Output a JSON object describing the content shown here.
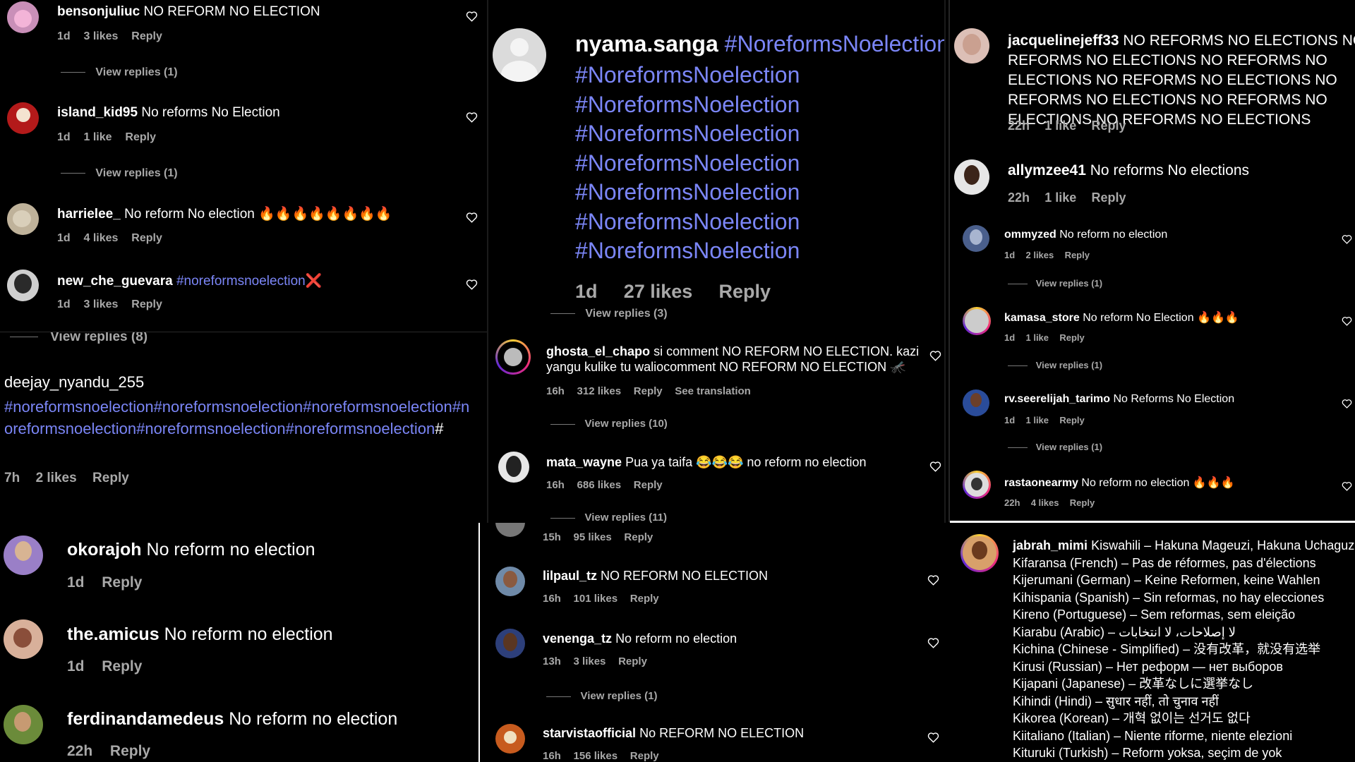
{
  "p1": {
    "comments": [
      {
        "user": "bensonjuliuc",
        "text": "NO REFORM NO ELECTION",
        "time": "1d",
        "likes": "3 likes",
        "reply": "Reply",
        "replies": "View replies (1)"
      },
      {
        "user": "island_kid95",
        "text": "No reforms No Election",
        "time": "1d",
        "likes": "1 like",
        "reply": "Reply",
        "replies": "View replies (1)"
      },
      {
        "user": "harrielee_",
        "text": "No reform No election 🔥🔥🔥🔥🔥🔥🔥🔥",
        "time": "1d",
        "likes": "4 likes",
        "reply": "Reply"
      },
      {
        "user": "new_che_guevara",
        "tag": "#noreformsnoelection",
        "emoji": "❌",
        "time": "1d",
        "likes": "3 likes",
        "reply": "Reply"
      }
    ],
    "replies_bottom": "View replies (8)"
  },
  "p2": {
    "user": "deejay_nyandu_255",
    "tags": "#noreformsnoelection#noreformsnoelection#noreformsnoelection#noreformsnoelection#noreformsnoelection#noreformsnoelection",
    "tail": "#",
    "time": "7h",
    "likes": "2 likes",
    "reply": "Reply"
  },
  "p3": {
    "comments": [
      {
        "user": "okorajoh",
        "text": "No reform no election",
        "time": "1d",
        "reply": "Reply"
      },
      {
        "user": "the.amicus",
        "text": "No reform no election",
        "time": "1d",
        "reply": "Reply"
      },
      {
        "user": "ferdinandamedeus",
        "text": "No reform no election",
        "time": "22h",
        "reply": "Reply"
      }
    ]
  },
  "p4": {
    "user": "nyama.sanga",
    "tag": "#NoreformsNoelection",
    "tags": [
      "#NoreformsNoelection",
      "#NoreformsNoelection",
      "#NoreformsNoelection",
      "#NoreformsNoelection",
      "#NoreformsNoelection",
      "#NoreformsNoelection",
      "#NoreformsNoelection"
    ],
    "time": "1d",
    "likes": "27 likes",
    "reply": "Reply",
    "replies_cut": "View replies (3)"
  },
  "p5": {
    "comments": [
      {
        "user": "ghosta_el_chapo",
        "text": "si comment NO REFORM NO ELECTION. kazi yangu kulike tu waliocomment NO REFORM NO ELECTION 🦟",
        "time": "16h",
        "likes": "312 likes",
        "reply": "Reply",
        "translate": "See translation",
        "replies": "View replies (10)"
      },
      {
        "user": "mata_wayne",
        "text": "Pua ya taifa 😂😂😂 no reform no election",
        "time": "16h",
        "likes": "686 likes",
        "reply": "Reply",
        "replies": "View replies (11)"
      }
    ]
  },
  "p6": {
    "partial": {
      "time": "15h",
      "likes": "95 likes",
      "reply": "Reply"
    },
    "comments": [
      {
        "user": "lilpaul_tz",
        "text": "NO REFORM NO ELECTION",
        "time": "16h",
        "likes": "101 likes",
        "reply": "Reply"
      },
      {
        "user": "venenga_tz",
        "text": "No reform no election",
        "time": "13h",
        "likes": "3 likes",
        "reply": "Reply",
        "replies": "View replies (1)"
      },
      {
        "user": "starvistaofficial",
        "text": "No REFORM NO ELECTION",
        "time": "16h",
        "likes": "156 likes",
        "reply": "Reply"
      }
    ]
  },
  "p7": {
    "comments": [
      {
        "user": "jacquelinejeff33",
        "text": "NO REFORMS NO ELECTIONS NO REFORMS NO ELECTIONS NO REFORMS NO ELECTIONS NO REFORMS NO ELECTIONS NO REFORMS NO ELECTIONS NO REFORMS NO ELECTIONS NO REFORMS NO ELECTIONS",
        "time": "22h",
        "likes": "1 like",
        "reply": "Reply"
      },
      {
        "user": "allymzee41",
        "text": "No reforms No elections",
        "time": "22h",
        "likes": "1 like",
        "reply": "Reply"
      }
    ]
  },
  "p8": {
    "comments": [
      {
        "user": "ommyzed",
        "text": "No reform no election",
        "time": "1d",
        "likes": "2 likes",
        "reply": "Reply",
        "replies": "View replies (1)"
      },
      {
        "user": "kamasa_store",
        "text": "No reform No Election 🔥🔥🔥",
        "time": "1d",
        "likes": "1 like",
        "reply": "Reply",
        "replies": "View replies (1)"
      },
      {
        "user": "rv.seerelijah_tarimo",
        "text": "No Reforms No Election",
        "time": "1d",
        "likes": "1 like",
        "reply": "Reply",
        "replies": "View replies (1)"
      },
      {
        "user": "rastaonearmy",
        "text": "No reform no election 🔥🔥🔥",
        "time": "22h",
        "likes": "4 likes",
        "reply": "Reply"
      }
    ]
  },
  "p9": {
    "user": "jabrah_mimi",
    "lines": [
      "Kiswahili – Hakuna Mageuzi, Hakuna Uchaguzi",
      "Kifaransa (French) – Pas de réformes, pas d'élections",
      "Kijerumani (German) – Keine Reformen, keine Wahlen",
      "Kihispania (Spanish) – Sin reformas, no hay elecciones",
      "Kireno (Portuguese) – Sem reformas, sem eleição",
      "Kiarabu (Arabic) – لا إصلاحات، لا انتخابات",
      "Kichina (Chinese - Simplified) – 没有改革，就没有选举",
      "Kirusi (Russian) – Нет реформ — нет выборов",
      "Kijapani (Japanese) – 改革なしに選挙なし",
      "Kihindi (Hindi) – सुधार नहीं, तो चुनाव नहीं",
      "Kikorea (Korean) – 개혁 없이는 선거도 없다",
      "Kiitaliano (Italian) – Niente riforme, niente elezioni",
      "Kituruki (Turkish) – Reform yoksa, seçim de yok"
    ]
  }
}
